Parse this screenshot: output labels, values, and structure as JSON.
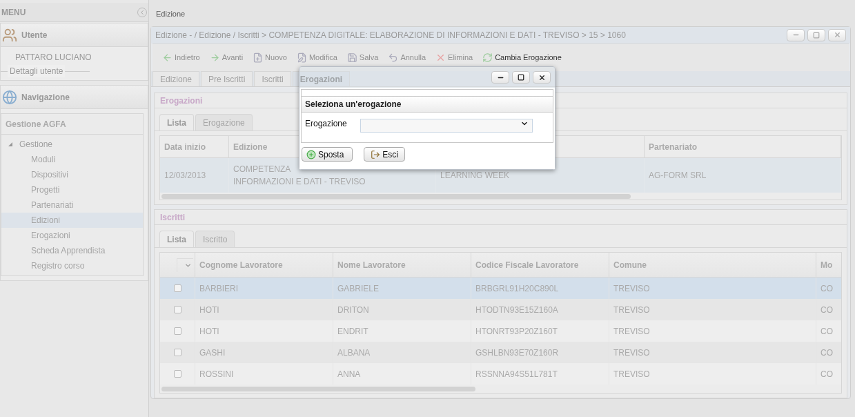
{
  "sidebar": {
    "title": "MENU",
    "user_panel": {
      "title": "Utente",
      "user_name": "PATTARO LUCIANO",
      "details_label": "Dettagli utente"
    },
    "nav_panel": {
      "title": "Navigazione",
      "group_title": "Gestione AGFA",
      "tree": [
        {
          "label": "Gestione",
          "expanded": true,
          "children": [
            {
              "label": "Moduli",
              "selected": false
            },
            {
              "label": "Dispositivi",
              "selected": false
            },
            {
              "label": "Progetti",
              "selected": false
            },
            {
              "label": "Partenariati",
              "selected": false
            },
            {
              "label": "Edizioni",
              "selected": true
            },
            {
              "label": "Erogazioni",
              "selected": false
            },
            {
              "label": "Scheda Apprendista",
              "selected": false
            },
            {
              "label": "Registro corso",
              "selected": false
            }
          ]
        }
      ]
    }
  },
  "page_tab": "Edizione",
  "window": {
    "title": "Edizione - / Edizione / Iscritti > COMPETENZA DIGITALE: ELABORAZIONE DI INFORMAZIONI E DATI - TREVISO > 15 > 1060",
    "toolbar": [
      {
        "label": "Indietro",
        "kind": "back",
        "disabled": true
      },
      {
        "label": "Avanti",
        "kind": "forward",
        "disabled": true
      },
      {
        "label": "Nuovo",
        "kind": "new",
        "disabled": true
      },
      {
        "label": "Modifica",
        "kind": "edit",
        "disabled": true
      },
      {
        "label": "Salva",
        "kind": "save",
        "disabled": true
      },
      {
        "label": "Annulla",
        "kind": "undo",
        "disabled": true
      },
      {
        "label": "Elimina",
        "kind": "delete",
        "disabled": true
      },
      {
        "label": "Cambia Erogazione",
        "kind": "swap",
        "disabled": false
      }
    ],
    "tabs": [
      {
        "label": "Edizione",
        "selected": false
      },
      {
        "label": "Pre Iscritti",
        "selected": false
      },
      {
        "label": "Iscritti",
        "selected": false
      },
      {
        "label": "Erogazioni",
        "selected": true
      }
    ],
    "erogazioni": {
      "title": "Erogazioni",
      "tabs": [
        {
          "label": "Lista",
          "selected": true
        },
        {
          "label": "Erogazione",
          "selected": false
        }
      ],
      "columns": [
        "Data inizio",
        "Edizione",
        "",
        "Partenariato"
      ],
      "rows": [
        {
          "cells": [
            "12/03/2013",
            "COMPETENZA\nINFORMAZIONI E DATI - TREVISO",
            "LEARNING WEEK",
            "AG-FORM SRL"
          ],
          "selected": true
        }
      ]
    },
    "iscritti": {
      "title": "Iscritti",
      "tabs": [
        {
          "label": "Lista",
          "selected": true
        },
        {
          "label": "Iscritto",
          "selected": false
        }
      ],
      "columns": [
        "Cognome Lavoratore",
        "Nome Lavoratore",
        "Codice Fiscale Lavoratore",
        "Comune",
        "Mo"
      ],
      "rows": [
        {
          "checked": false,
          "selected": true,
          "cells": [
            "BARBIERI",
            "GABRIELE",
            "BRBGRL91H20C890L",
            "TREVISO",
            "CO"
          ]
        },
        {
          "checked": false,
          "selected": false,
          "cells": [
            "HOTI",
            "DRITON",
            "HTODTN93E15Z160A",
            "TREVISO",
            "CO"
          ]
        },
        {
          "checked": false,
          "selected": false,
          "cells": [
            "HOTI",
            "ENDRIT",
            "HTONRT93P20Z160T",
            "TREVISO",
            "CO"
          ]
        },
        {
          "checked": false,
          "selected": false,
          "cells": [
            "GASHI",
            "ALBANA",
            "GSHLBN93E70Z160R",
            "TREVISO",
            "CO"
          ]
        },
        {
          "checked": false,
          "selected": false,
          "cells": [
            "ROSSINI",
            "ANNA",
            "RSSNNA94S51L781T",
            "TREVISO",
            "CO"
          ]
        }
      ]
    }
  },
  "dialog": {
    "section_title": "Seleziona un'erogazione",
    "field_label": "Erogazione",
    "buttons": [
      {
        "label": "Sposta",
        "kind": "move"
      },
      {
        "label": "Esci",
        "kind": "exit"
      }
    ]
  }
}
